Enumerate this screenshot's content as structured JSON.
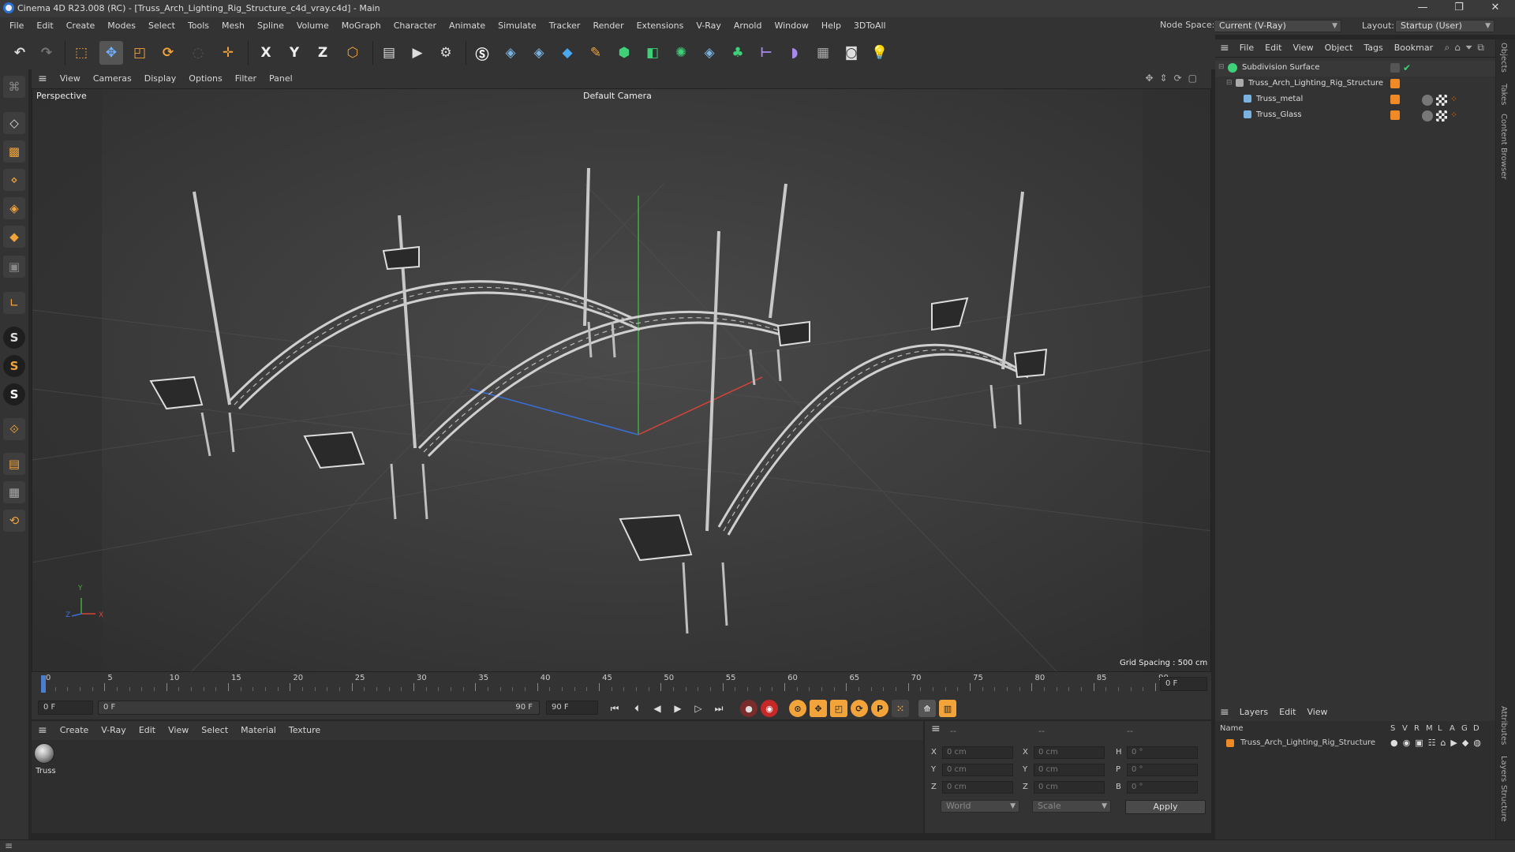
{
  "window": {
    "title": "Cinema 4D R23.008 (RC) - [Truss_Arch_Lighting_Rig_Structure_c4d_vray.c4d] - Main",
    "minimize": "—",
    "maximize": "❐",
    "close": "✕"
  },
  "menu": {
    "items": [
      "File",
      "Edit",
      "Create",
      "Modes",
      "Select",
      "Tools",
      "Mesh",
      "Spline",
      "Volume",
      "MoGraph",
      "Character",
      "Animate",
      "Simulate",
      "Tracker",
      "Render",
      "Extensions",
      "V-Ray",
      "Arnold",
      "Window",
      "Help",
      "3DToAll"
    ],
    "node_space_label": "Node Space:",
    "node_space_value": "Current (V-Ray)",
    "layout_label": "Layout:",
    "layout_value": "Startup (User)"
  },
  "toolbar": {
    "axis_x": "X",
    "axis_y": "Y",
    "axis_z": "Z"
  },
  "viewport": {
    "menu": [
      "View",
      "Cameras",
      "Display",
      "Options",
      "Filter",
      "Panel"
    ],
    "mode_label": "Perspective",
    "camera_label": "Default Camera",
    "grid_spacing": "Grid Spacing : 500 cm",
    "axis_y": "Y",
    "axis_z": "Z",
    "axis_x": "X"
  },
  "timeline": {
    "ticks": [
      "0",
      "5",
      "10",
      "15",
      "20",
      "25",
      "30",
      "35",
      "40",
      "45",
      "50",
      "55",
      "60",
      "65",
      "70",
      "75",
      "80",
      "85",
      "90"
    ],
    "frame_right": "0 F",
    "current_frame": "0 F",
    "range_start": "0 F",
    "range_end": "90 F",
    "max_frame": "90 F"
  },
  "materials": {
    "menu": [
      "Create",
      "V-Ray",
      "Edit",
      "View",
      "Select",
      "Material",
      "Texture"
    ],
    "items": [
      {
        "name": "Truss"
      }
    ]
  },
  "coordinates": {
    "header_a": "--",
    "header_b": "--",
    "header_c": "--",
    "pos": [
      {
        "axis": "X",
        "value": "0 cm"
      },
      {
        "axis": "Y",
        "value": "0 cm"
      },
      {
        "axis": "Z",
        "value": "0 cm"
      }
    ],
    "size": [
      {
        "axis": "X",
        "value": "0 cm"
      },
      {
        "axis": "Y",
        "value": "0 cm"
      },
      {
        "axis": "Z",
        "value": "0 cm"
      }
    ],
    "rot": [
      {
        "axis": "H",
        "value": "0 °"
      },
      {
        "axis": "P",
        "value": "0 °"
      },
      {
        "axis": "B",
        "value": "0 °"
      }
    ],
    "space": "World",
    "mode": "Scale",
    "apply": "Apply"
  },
  "object_manager": {
    "menu": [
      "File",
      "Edit",
      "View",
      "Object",
      "Tags",
      "Bookmar"
    ],
    "objects": [
      {
        "name": "Subdivision Surface",
        "level": 0
      },
      {
        "name": "Truss_Arch_Lighting_Rig_Structure",
        "level": 1
      },
      {
        "name": "Truss_metal",
        "level": 2
      },
      {
        "name": "Truss_Glass",
        "level": 2
      }
    ]
  },
  "layers": {
    "menu": [
      "Layers",
      "Edit",
      "View"
    ],
    "col_name": "Name",
    "cols": [
      "S",
      "V",
      "R",
      "M",
      "L",
      "A",
      "G",
      "D"
    ],
    "items": [
      {
        "name": "Truss_Arch_Lighting_Rig_Structure"
      }
    ]
  },
  "side_tabs": [
    "Objects",
    "Takes",
    "Content Browser",
    "Attributes",
    "Layers",
    "Structure"
  ],
  "colors": {
    "accent": "#f08a24",
    "axis_x": "#d9443a",
    "axis_y": "#3fae3f",
    "axis_z": "#3a6fd9"
  }
}
